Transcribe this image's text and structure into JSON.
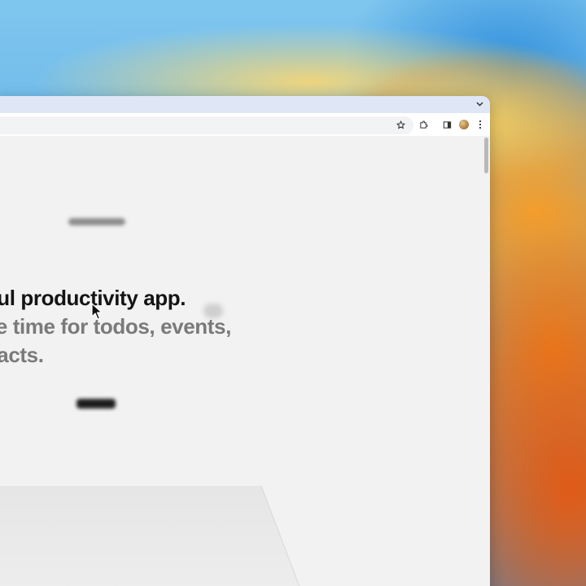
{
  "browser": {
    "toolbar_icons": [
      "star-icon",
      "extension-puzzle-icon",
      "side-panel-icon",
      "profile-avatar",
      "kebab-menu-icon"
    ],
    "tab_strip_icon": "chevron-down-icon"
  },
  "page": {
    "headline": {
      "line1": "ful productivity app.",
      "line2": "le time for todos, events,",
      "line3": "tacts."
    }
  },
  "colors": {
    "headline_primary": "#141414",
    "headline_secondary": "#7a7a7a",
    "page_background": "#f2f2f2",
    "tab_strip": "#dfe7f7"
  }
}
